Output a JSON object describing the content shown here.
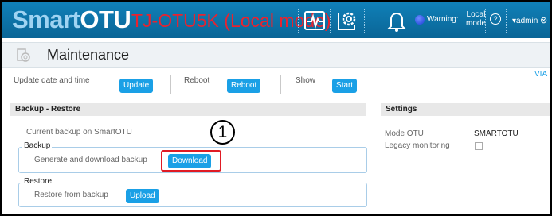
{
  "header": {
    "brand_pre": "Smart",
    "brand_main": "OTU",
    "mode_title": "TJ-OTU5K (Local mode)",
    "warning_label": "Warning:",
    "local_mode_line1": "Local",
    "local_mode_line2": "mode",
    "user": "▾admin",
    "help_icon": "?",
    "close_icon": "⊗",
    "colors": {
      "header_bg": "#0a6ea0",
      "mode_title": "#e8232f",
      "warning_dot": "#1c3fd6"
    }
  },
  "page": {
    "title": "Maintenance"
  },
  "toolbar": {
    "update_label": "Update date and time",
    "update_button": "Update",
    "reboot_label": "Reboot",
    "reboot_button": "Reboot",
    "show_label": "Show",
    "start_button": "Start",
    "via_text": "VIA"
  },
  "backup_restore": {
    "title": "Backup - Restore",
    "current_backup": "Current backup on SmartOTU",
    "backup_legend": "Backup",
    "backup_text": "Generate and download backup",
    "download_button": "Download",
    "restore_legend": "Restore",
    "restore_text": "Restore from backup",
    "upload_button": "Upload"
  },
  "settings": {
    "title": "Settings",
    "mode_label": "Mode OTU",
    "mode_value": "SMARTOTU",
    "legacy_label": "Legacy monitoring",
    "legacy_checked": false
  },
  "annotation": {
    "callout_number": "1",
    "highlight_color": "#e01b24"
  }
}
